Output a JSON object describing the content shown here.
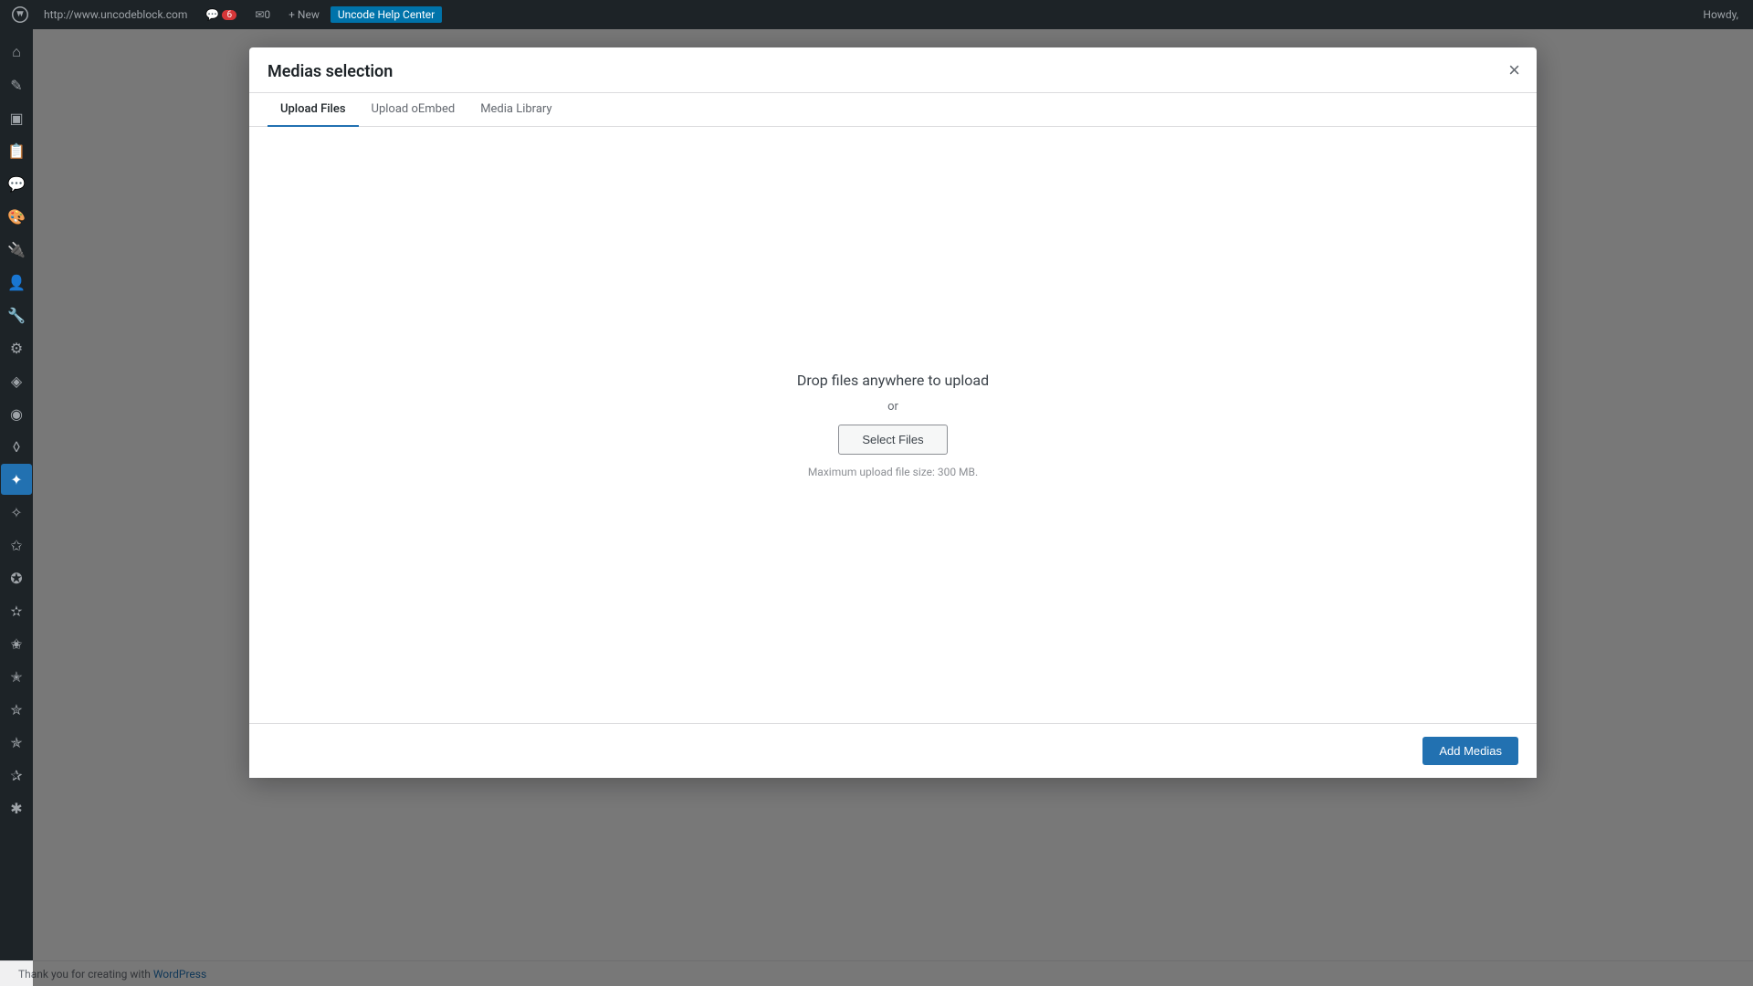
{
  "adminBar": {
    "logoSymbol": "⊕",
    "siteUrl": "http://www.uncodeblock.com",
    "commentCount": 6,
    "messageCount": 0,
    "newLabel": "+ New",
    "helpCenterLabel": "Uncode Help Center",
    "howdyText": "Howdy,"
  },
  "sidebar": {
    "icons": [
      {
        "name": "dashboard-icon",
        "symbol": "⌂"
      },
      {
        "name": "posts-icon",
        "symbol": "✎"
      },
      {
        "name": "media-icon",
        "symbol": "▣"
      },
      {
        "name": "pages-icon",
        "symbol": "📄"
      },
      {
        "name": "comments-icon",
        "symbol": "💬"
      },
      {
        "name": "appearance-icon",
        "symbol": "🎨"
      },
      {
        "name": "plugins-icon",
        "symbol": "⚙"
      },
      {
        "name": "users-icon",
        "symbol": "👤"
      },
      {
        "name": "tools-icon",
        "symbol": "🔧"
      },
      {
        "name": "settings-icon",
        "symbol": "⚙"
      },
      {
        "name": "custom1-icon",
        "symbol": "◈"
      },
      {
        "name": "custom2-icon",
        "symbol": "◉"
      },
      {
        "name": "custom3-icon",
        "symbol": "◊"
      },
      {
        "name": "custom4-icon",
        "symbol": "✦"
      },
      {
        "name": "custom5-icon",
        "symbol": "✧"
      },
      {
        "name": "custom6-icon",
        "symbol": "✩"
      },
      {
        "name": "custom7-icon",
        "symbol": "✪"
      },
      {
        "name": "custom8-icon",
        "symbol": "✫"
      }
    ]
  },
  "modal": {
    "title": "Medias selection",
    "closeSymbol": "×",
    "tabs": [
      {
        "id": "upload-files",
        "label": "Upload Files",
        "active": true
      },
      {
        "id": "upload-oembed",
        "label": "Upload oEmbed",
        "active": false
      },
      {
        "id": "media-library",
        "label": "Media Library",
        "active": false
      }
    ],
    "uploadArea": {
      "dropText": "Drop files anywhere to upload",
      "orText": "or",
      "selectFilesLabel": "Select Files",
      "maxSizeText": "Maximum upload file size: 300 MB."
    },
    "footer": {
      "addMediasLabel": "Add Medias"
    }
  },
  "bottomBar": {
    "thanksText": "Thank you for creating with",
    "wordpressLink": "WordPress"
  }
}
